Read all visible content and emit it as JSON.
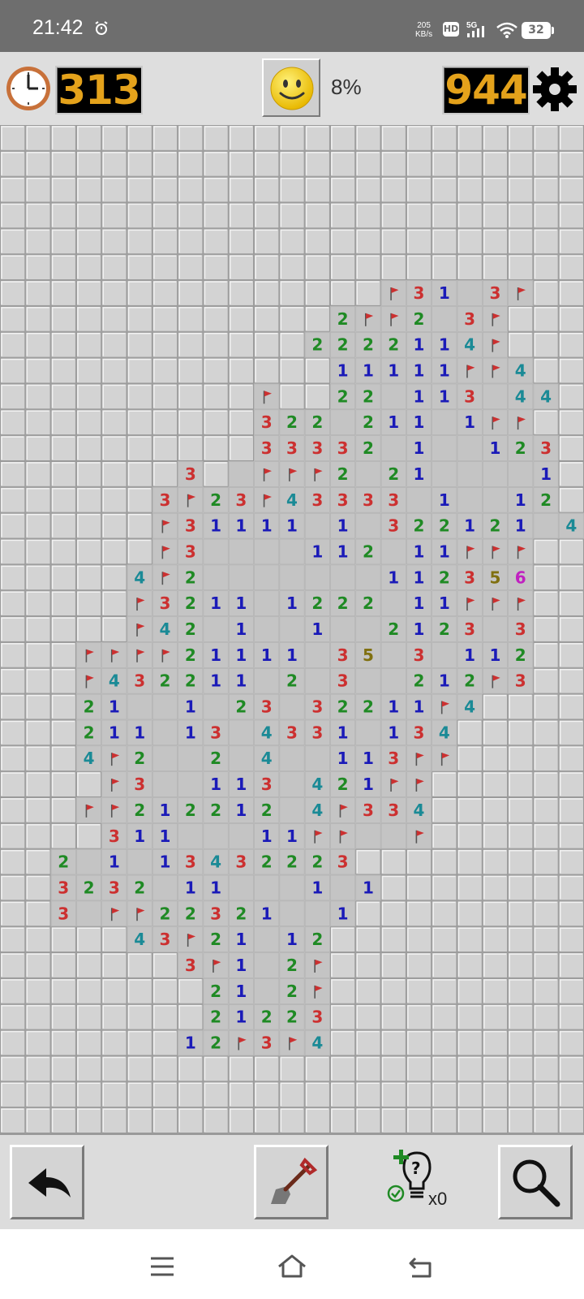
{
  "status_bar": {
    "time": "21:42",
    "net_speed_value": "205",
    "net_speed_unit": "KB/s",
    "hd_label": "HD",
    "network_label": "5G",
    "battery_level": "32",
    "icons": [
      "alarm-icon",
      "signal-icon",
      "wifi-icon",
      "battery-icon"
    ]
  },
  "header": {
    "timer_value": "313",
    "progress_text": "8%",
    "mines_remaining": "944",
    "icons": [
      "clock-icon",
      "smiley-icon",
      "gear-icon"
    ]
  },
  "board": {
    "rows": 39,
    "cols": 23,
    "cell_legend": {
      ".": "covered",
      " ": "revealed-empty",
      "F": "flag",
      "1-8": "revealed-number"
    },
    "grid": [
      ".......................",
      ".......................",
      ".......................",
      ".......................",
      ".......................",
      ".......................",
      "...............F31 3F..",
      ".............2FF2 3F..",
      "............2222114F..",
      ".............11111FF4.",
      "..........F..22 113 44.",
      "..........322 211 1FF.",
      "..........33332 1  123.",
      ".......3. FFF2 21    1.",
      "......3F23F43333 1  12.",
      "......F31111 1 322121 4F.",
      "......F3    112 11FFF.",
      ".....4F2       112356.",
      ".....F3211 1222 11FFF.",
      ".....F42 1  1  2123 3.",
      "...FFFF21111 35 3 112.",
      "...F432211 2 3  212F3.",
      "...21  1 23 32211F4..",
      "...211 13 4331 134...",
      "...4F2  2 4  113FF...",
      "....F3  113 421FF....",
      "...FF212212 4F334....",
      "....311   11FF  F....",
      "..2 1 13432223.......",
      "..3232 11   1 1.......",
      "..3 FF22321  1.......",
      ".....43F21 12........",
      ".......3F1 2F........",
      "........21 2F........",
      "........21223........",
      ".......12F3F4........",
      ".......................",
      ".......................",
      "......................."
    ],
    "colors": {
      "1": "#1a1ab8",
      "2": "#1f8a24",
      "3": "#cc3030",
      "4": "#1a8a96",
      "5": "#807010",
      "6": "#c020c0",
      "flag": "#cc3030"
    }
  },
  "toolbar": {
    "hint_count": "x0",
    "icons": [
      "undo-icon",
      "shovel-icon",
      "hint-lightbulb-icon",
      "magnifier-icon"
    ]
  },
  "nav_bar": {
    "icons": [
      "menu-icon",
      "home-icon",
      "back-icon"
    ]
  }
}
